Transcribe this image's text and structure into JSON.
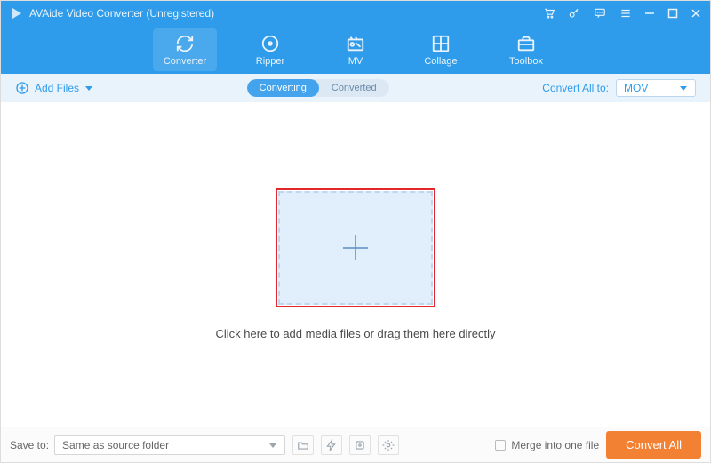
{
  "titlebar": {
    "title": "AVAide Video Converter (Unregistered)"
  },
  "tabs": {
    "converter": "Converter",
    "ripper": "Ripper",
    "mv": "MV",
    "collage": "Collage",
    "toolbox": "Toolbox"
  },
  "toolbar": {
    "add_files": "Add Files",
    "converting": "Converting",
    "converted": "Converted",
    "convert_all_to": "Convert All to:",
    "format": "MOV"
  },
  "main": {
    "hint": "Click here to add media files or drag them here directly"
  },
  "footer": {
    "save_to_label": "Save to:",
    "save_to_value": "Same as source folder",
    "merge_label": "Merge into one file",
    "convert_all": "Convert All"
  }
}
